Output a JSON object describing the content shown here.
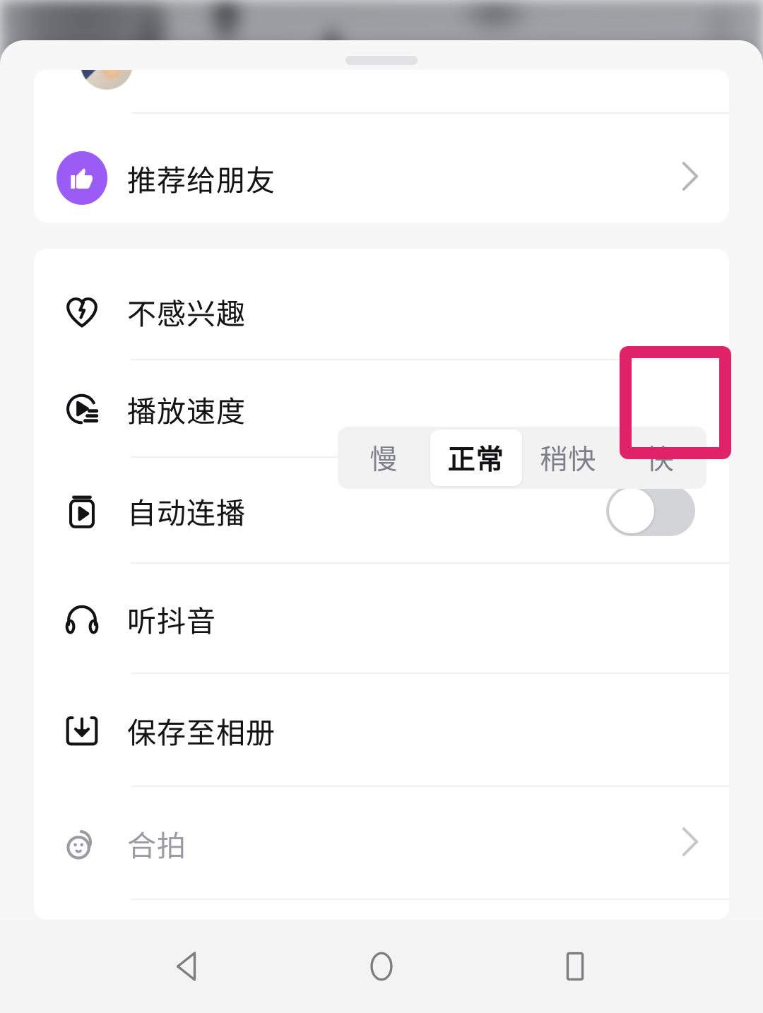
{
  "app": {
    "sheet_title": "",
    "handle": "drag-handle"
  },
  "colors": {
    "accent_purple": "#9a5cf5",
    "highlight_pink": "#e02368",
    "card_bg": "#ffffff",
    "sheet_bg": "#f7f7f8",
    "text_primary": "#141416",
    "text_disabled": "#9b9ba1",
    "segment_track": "#f2f2f3",
    "toggle_off_track": "#d3d4d7"
  },
  "card_top": {
    "rows": [
      {
        "id": "recommend-to-friends",
        "label": "推荐给朋友",
        "icon": "thumbs-up-icon",
        "accessory": "chevron-right-icon",
        "disabled": false
      }
    ]
  },
  "card_bottom": {
    "rows": [
      {
        "id": "not-interested",
        "label": "不感兴趣",
        "icon": "broken-heart-icon",
        "accessory": "none",
        "disabled": false
      },
      {
        "id": "playback-speed",
        "label": "播放速度",
        "icon": "playback-speed-icon",
        "accessory": "segmented-control",
        "disabled": false
      },
      {
        "id": "auto-play-next",
        "label": "自动连播",
        "icon": "auto-play-icon",
        "accessory": "toggle",
        "disabled": false
      },
      {
        "id": "listen-to-douyin",
        "label": "听抖音",
        "icon": "headphones-icon",
        "accessory": "none",
        "disabled": false
      },
      {
        "id": "save-to-album",
        "label": "保存至相册",
        "icon": "download-icon",
        "accessory": "none",
        "disabled": false
      },
      {
        "id": "duet",
        "label": "合拍",
        "icon": "duet-face-icon",
        "accessory": "chevron-right-icon",
        "disabled": true
      }
    ]
  },
  "playback_speed": {
    "options": [
      "慢",
      "正常",
      "稍快",
      "快"
    ],
    "selected": "正常",
    "selected_index": 1,
    "highlighted_option": "快",
    "highlighted_index": 3
  },
  "auto_play": {
    "state": "off"
  },
  "navbar": {
    "buttons": [
      {
        "id": "back",
        "icon": "back-triangle-icon"
      },
      {
        "id": "home",
        "icon": "home-circle-icon"
      },
      {
        "id": "recents",
        "icon": "recents-square-icon"
      }
    ]
  }
}
